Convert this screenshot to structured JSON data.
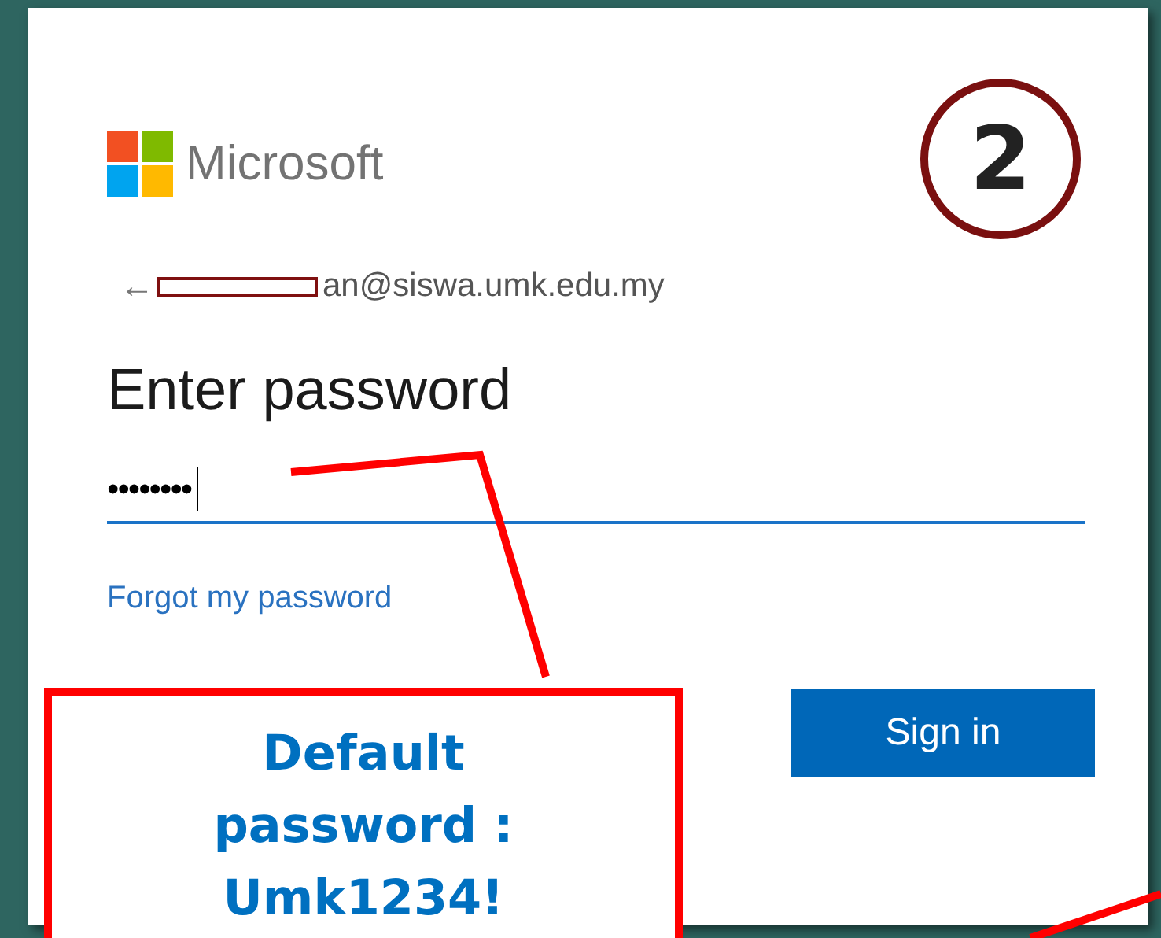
{
  "step_badge": "2",
  "sign_in": {
    "brand": "Microsoft",
    "back_arrow": "←",
    "email": "an@siswa.umk.edu.my",
    "heading": "Enter password",
    "password": "••••••••",
    "forgot_link": "Forgot my password",
    "button": "Sign in"
  },
  "callout": {
    "text": "Default password : Umk1234!"
  }
}
